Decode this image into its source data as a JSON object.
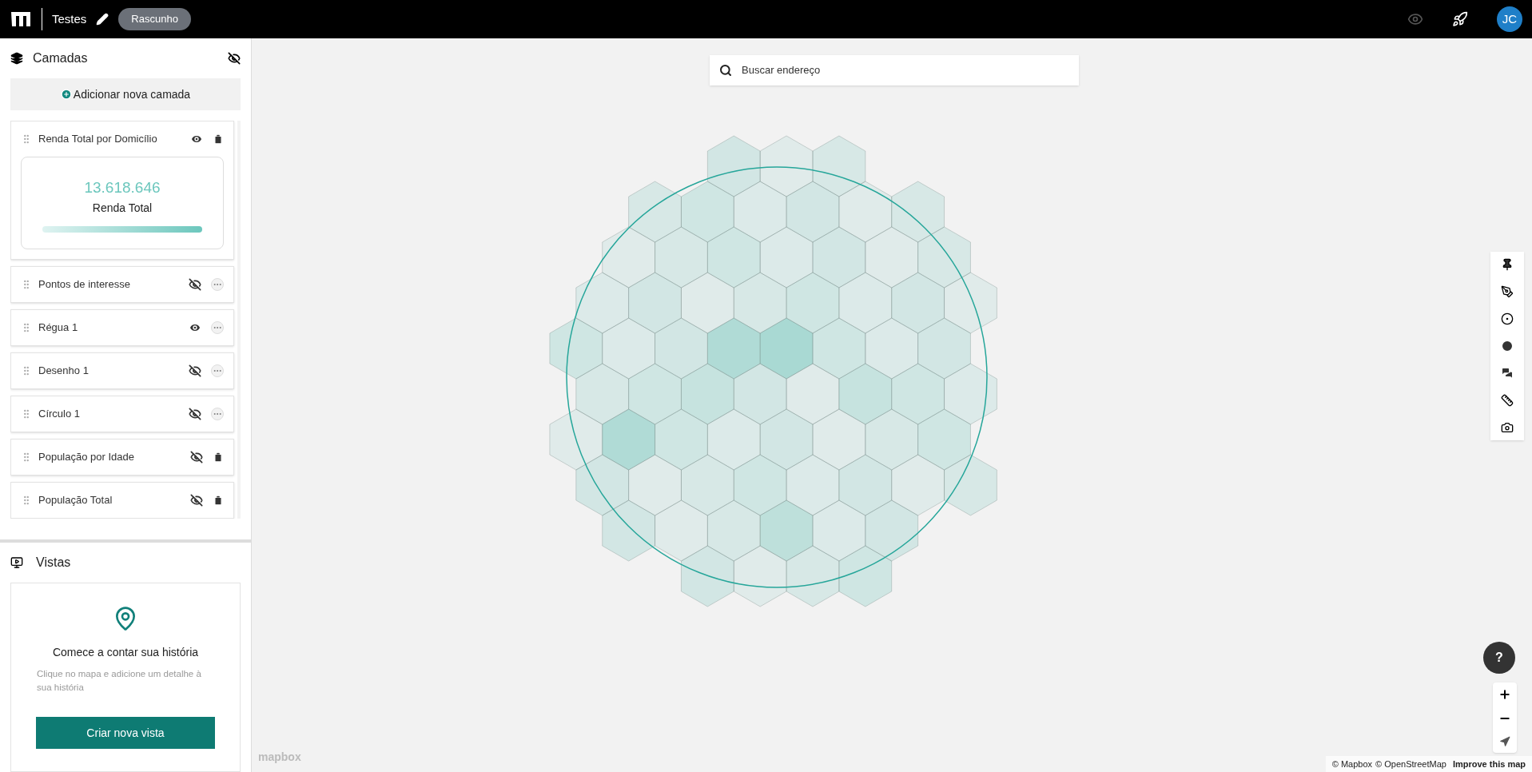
{
  "topbar": {
    "title": "Testes",
    "status": "Rascunho",
    "avatar": "JC"
  },
  "layers_panel": {
    "title": "Camadas",
    "add_button": "Adicionar nova camada",
    "layers": [
      {
        "name": "Renda Total por Domicílio",
        "visible": true,
        "kind": "delete",
        "expanded": true,
        "stat_value": "13.618.646",
        "stat_label": "Renda Total"
      },
      {
        "name": "Pontos de interesse",
        "visible": false,
        "kind": "more",
        "expanded": false
      },
      {
        "name": "Régua 1",
        "visible": true,
        "kind": "more",
        "expanded": false
      },
      {
        "name": "Desenho 1",
        "visible": false,
        "kind": "more",
        "expanded": false
      },
      {
        "name": "Círculo 1",
        "visible": false,
        "kind": "more",
        "expanded": false
      },
      {
        "name": "População por Idade",
        "visible": false,
        "kind": "delete",
        "expanded": false
      },
      {
        "name": "População Total",
        "visible": false,
        "kind": "delete",
        "expanded": false
      }
    ]
  },
  "views_panel": {
    "title": "Vistas",
    "empty_title": "Comece a contar sua história",
    "empty_text": "Clique no mapa e adicione um detalhe à sua história",
    "create_button": "Criar nova vista"
  },
  "map": {
    "search": {
      "placeholder": "Buscar endereço"
    },
    "help": "?",
    "logo": "mapbox",
    "attribution": [
      "© Mapbox",
      "© OpenStreetMap"
    ],
    "improve_link": "Improve this map"
  }
}
